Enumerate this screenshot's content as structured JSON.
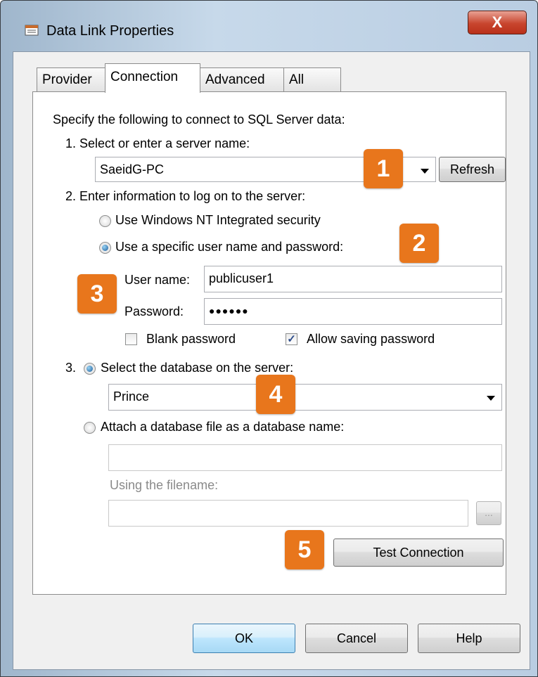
{
  "window": {
    "title": "Data Link Properties",
    "close_glyph": "X"
  },
  "tabs": [
    "Provider",
    "Connection",
    "Advanced",
    "All"
  ],
  "connection": {
    "intro": "Specify the following to connect to SQL Server data:",
    "step1_label": "1. Select or enter a server name:",
    "server_name": "SaeidG-PC",
    "refresh_label": "Refresh",
    "step2_label": "2. Enter information to log on to the server:",
    "radio_nt": "Use Windows NT Integrated security",
    "radio_specific": "Use a specific user name and password:",
    "username_label": "User name:",
    "username_value": "publicuser1",
    "password_label": "Password:",
    "password_value": "●●●●●●",
    "blank_password_label": "Blank password",
    "allow_saving_label": "Allow saving password",
    "step3_prefix": "3.",
    "radio_select_db": "Select the database on the server:",
    "database_value": "Prince",
    "radio_attach": "Attach a database file as a database name:",
    "attach_db_name": "",
    "filename_label": "Using the filename:",
    "filename_value": "",
    "browse_label": "...",
    "test_connection_label": "Test Connection"
  },
  "footer": {
    "ok_label": "OK",
    "cancel_label": "Cancel",
    "help_label": "Help"
  },
  "badges": [
    "1",
    "2",
    "3",
    "4",
    "5"
  ],
  "colors": {
    "badge": "#e8761c",
    "close": "#c8452e"
  }
}
